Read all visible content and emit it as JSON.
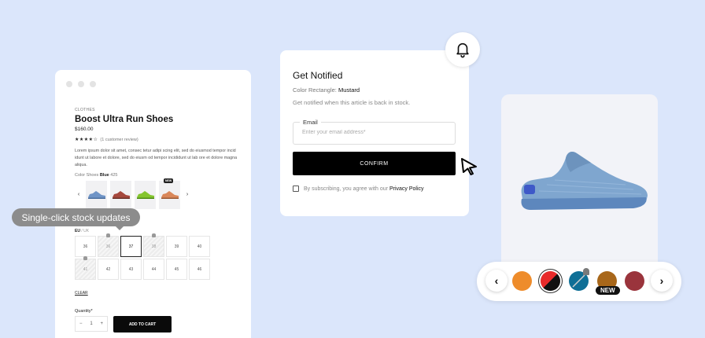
{
  "product": {
    "category": "CLOTHES",
    "title": "Boost Ultra Run Shoes",
    "price": "$160.00",
    "stars": "★★★★☆",
    "review_text": "(1 customer review)",
    "description": "Lorem ipsum dolor sit amet, consec tetur adipi scing elit, sed do eiusmod tempor incid idunt ut labore et dolore, sed do eiusm od tempor incididunt ut lab ore et dolore magna aliqua.",
    "color_label": "Color Shoes",
    "color_name": "Blue",
    "color_code": "425",
    "new_tag": "NEW",
    "size_region": "EU",
    "size_alt": "/ UK",
    "sizes": [
      "36",
      "36",
      "37",
      "38",
      "39",
      "40",
      "41",
      "42",
      "43",
      "44",
      "45",
      "46"
    ],
    "clear_label": "CLEAR",
    "quantity_label": "Quantity*",
    "quantity": "1",
    "minus": "−",
    "plus": "+",
    "add_to_cart": "ADD TO CART"
  },
  "tooltip": "Single-click stock updates",
  "notify": {
    "title": "Get Notified",
    "color_label": "Color Rectangle:",
    "color_value": "Mustard",
    "subtitle": "Get notified when this article is back in stock.",
    "email_label": "Email",
    "email_placeholder": "Enter your email address*",
    "confirm": "CONFIRM",
    "consent_text": "By subscribing, you agree with our",
    "privacy_link": "Privacy Policy"
  },
  "swatches": {
    "new_badge": "NEW",
    "colors": [
      "#ee8c2b",
      "#e82b2b",
      "#0f6f96",
      "#a8671a",
      "#9a343c"
    ]
  }
}
